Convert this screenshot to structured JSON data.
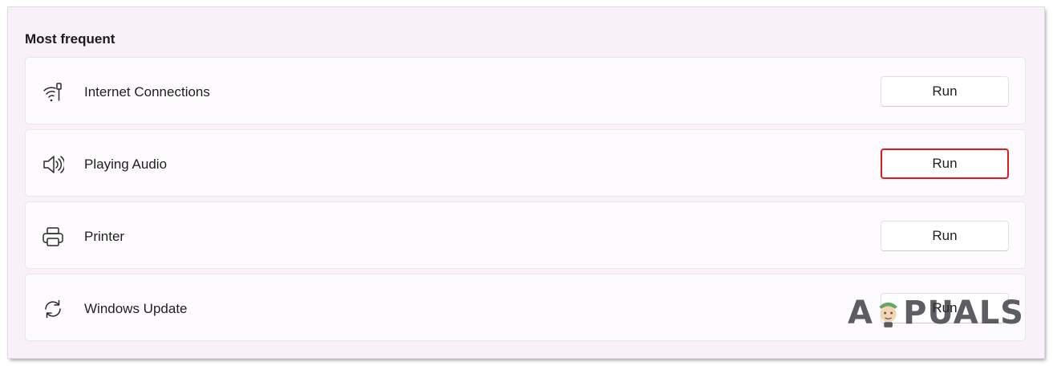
{
  "section": {
    "title": "Most frequent"
  },
  "rows": [
    {
      "icon": "wifi-network-icon",
      "label": "Internet Connections",
      "button": "Run",
      "highlighted": false
    },
    {
      "icon": "speaker-icon",
      "label": "Playing Audio",
      "button": "Run",
      "highlighted": true
    },
    {
      "icon": "printer-icon",
      "label": "Printer",
      "button": "Run",
      "highlighted": false
    },
    {
      "icon": "sync-icon",
      "label": "Windows Update",
      "button": "Run",
      "highlighted": false
    }
  ],
  "watermark": {
    "text_left": "A",
    "text_right": "PUALS"
  },
  "colors": {
    "background": "#f9f1f8",
    "row": "#fdfbfd",
    "highlight": "#e01b1b"
  }
}
